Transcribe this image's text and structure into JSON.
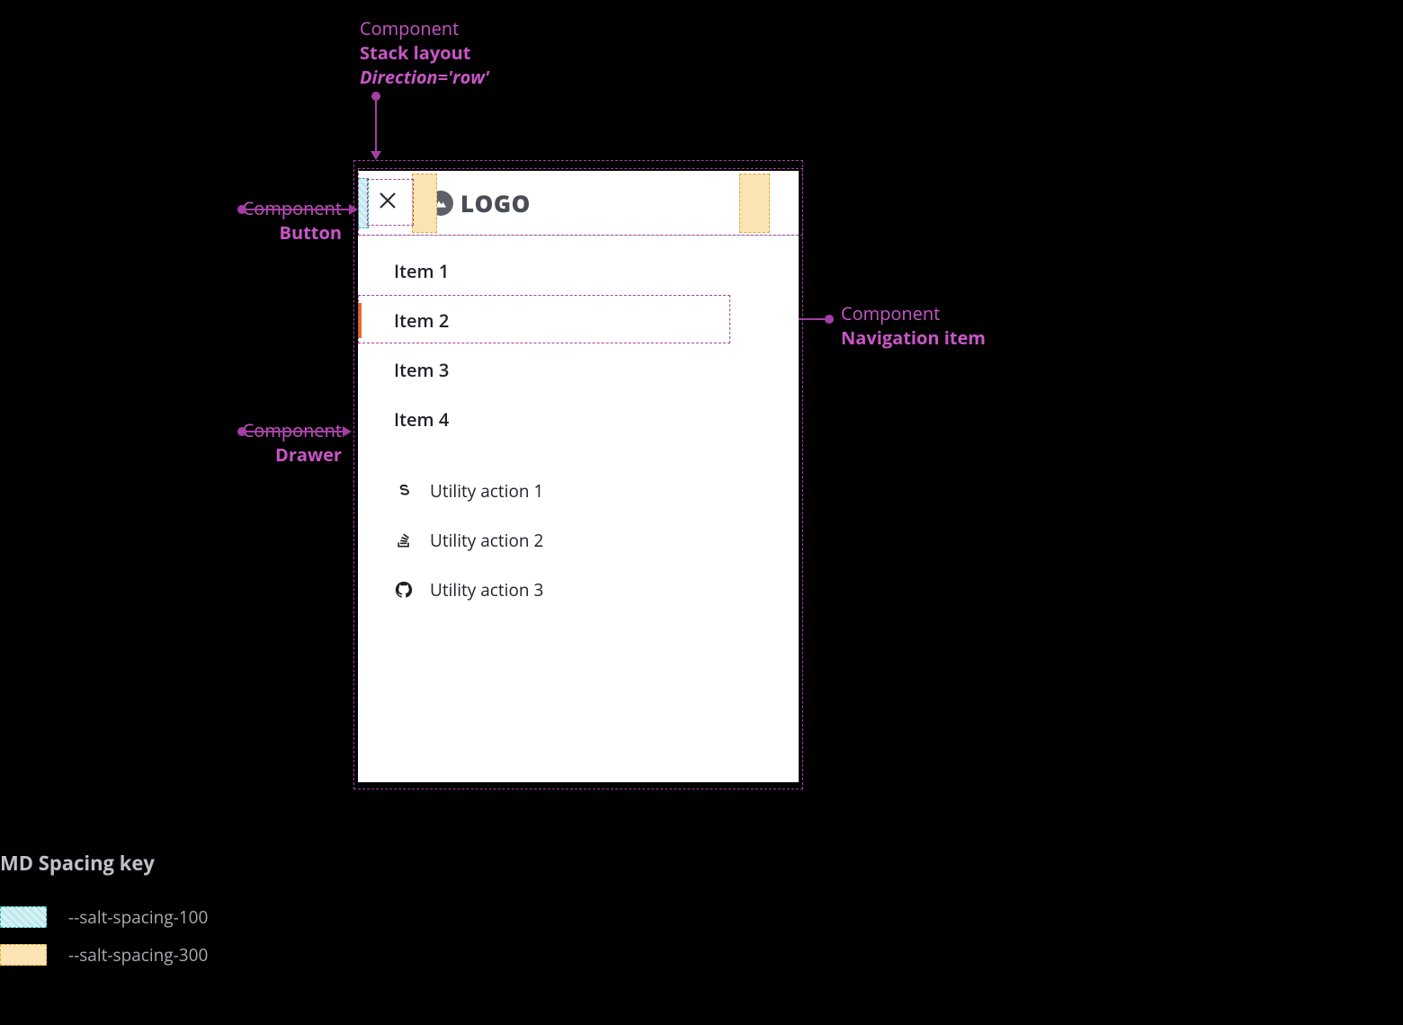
{
  "labels": {
    "component": "Component",
    "stack_title": "Stack layout",
    "stack_sub": "Direction='row'",
    "button": "Button",
    "drawer": "Drawer",
    "navitem": "Navigation item"
  },
  "header": {
    "logo_text": "LOGO"
  },
  "nav": {
    "items": [
      {
        "label": "Item 1",
        "active": false
      },
      {
        "label": "Item 2",
        "active": true
      },
      {
        "label": "Item 3",
        "active": false
      },
      {
        "label": "Item 4",
        "active": false
      }
    ]
  },
  "utils": {
    "items": [
      {
        "label": "Utility action 1",
        "icon": "symbol"
      },
      {
        "label": "Utility action 2",
        "icon": "stackoverflow"
      },
      {
        "label": "Utility action 3",
        "icon": "github"
      }
    ]
  },
  "legend": {
    "title": "MD Spacing key",
    "rows": [
      {
        "swatch": "s100",
        "label": "--salt-spacing-100"
      },
      {
        "swatch": "s300",
        "label": "--salt-spacing-300"
      }
    ]
  },
  "colors": {
    "annotation": "#c956c7",
    "active_indicator": "#ea6a1a",
    "spacing100": "#bfe8ec",
    "spacing300": "#fbe4b4"
  }
}
